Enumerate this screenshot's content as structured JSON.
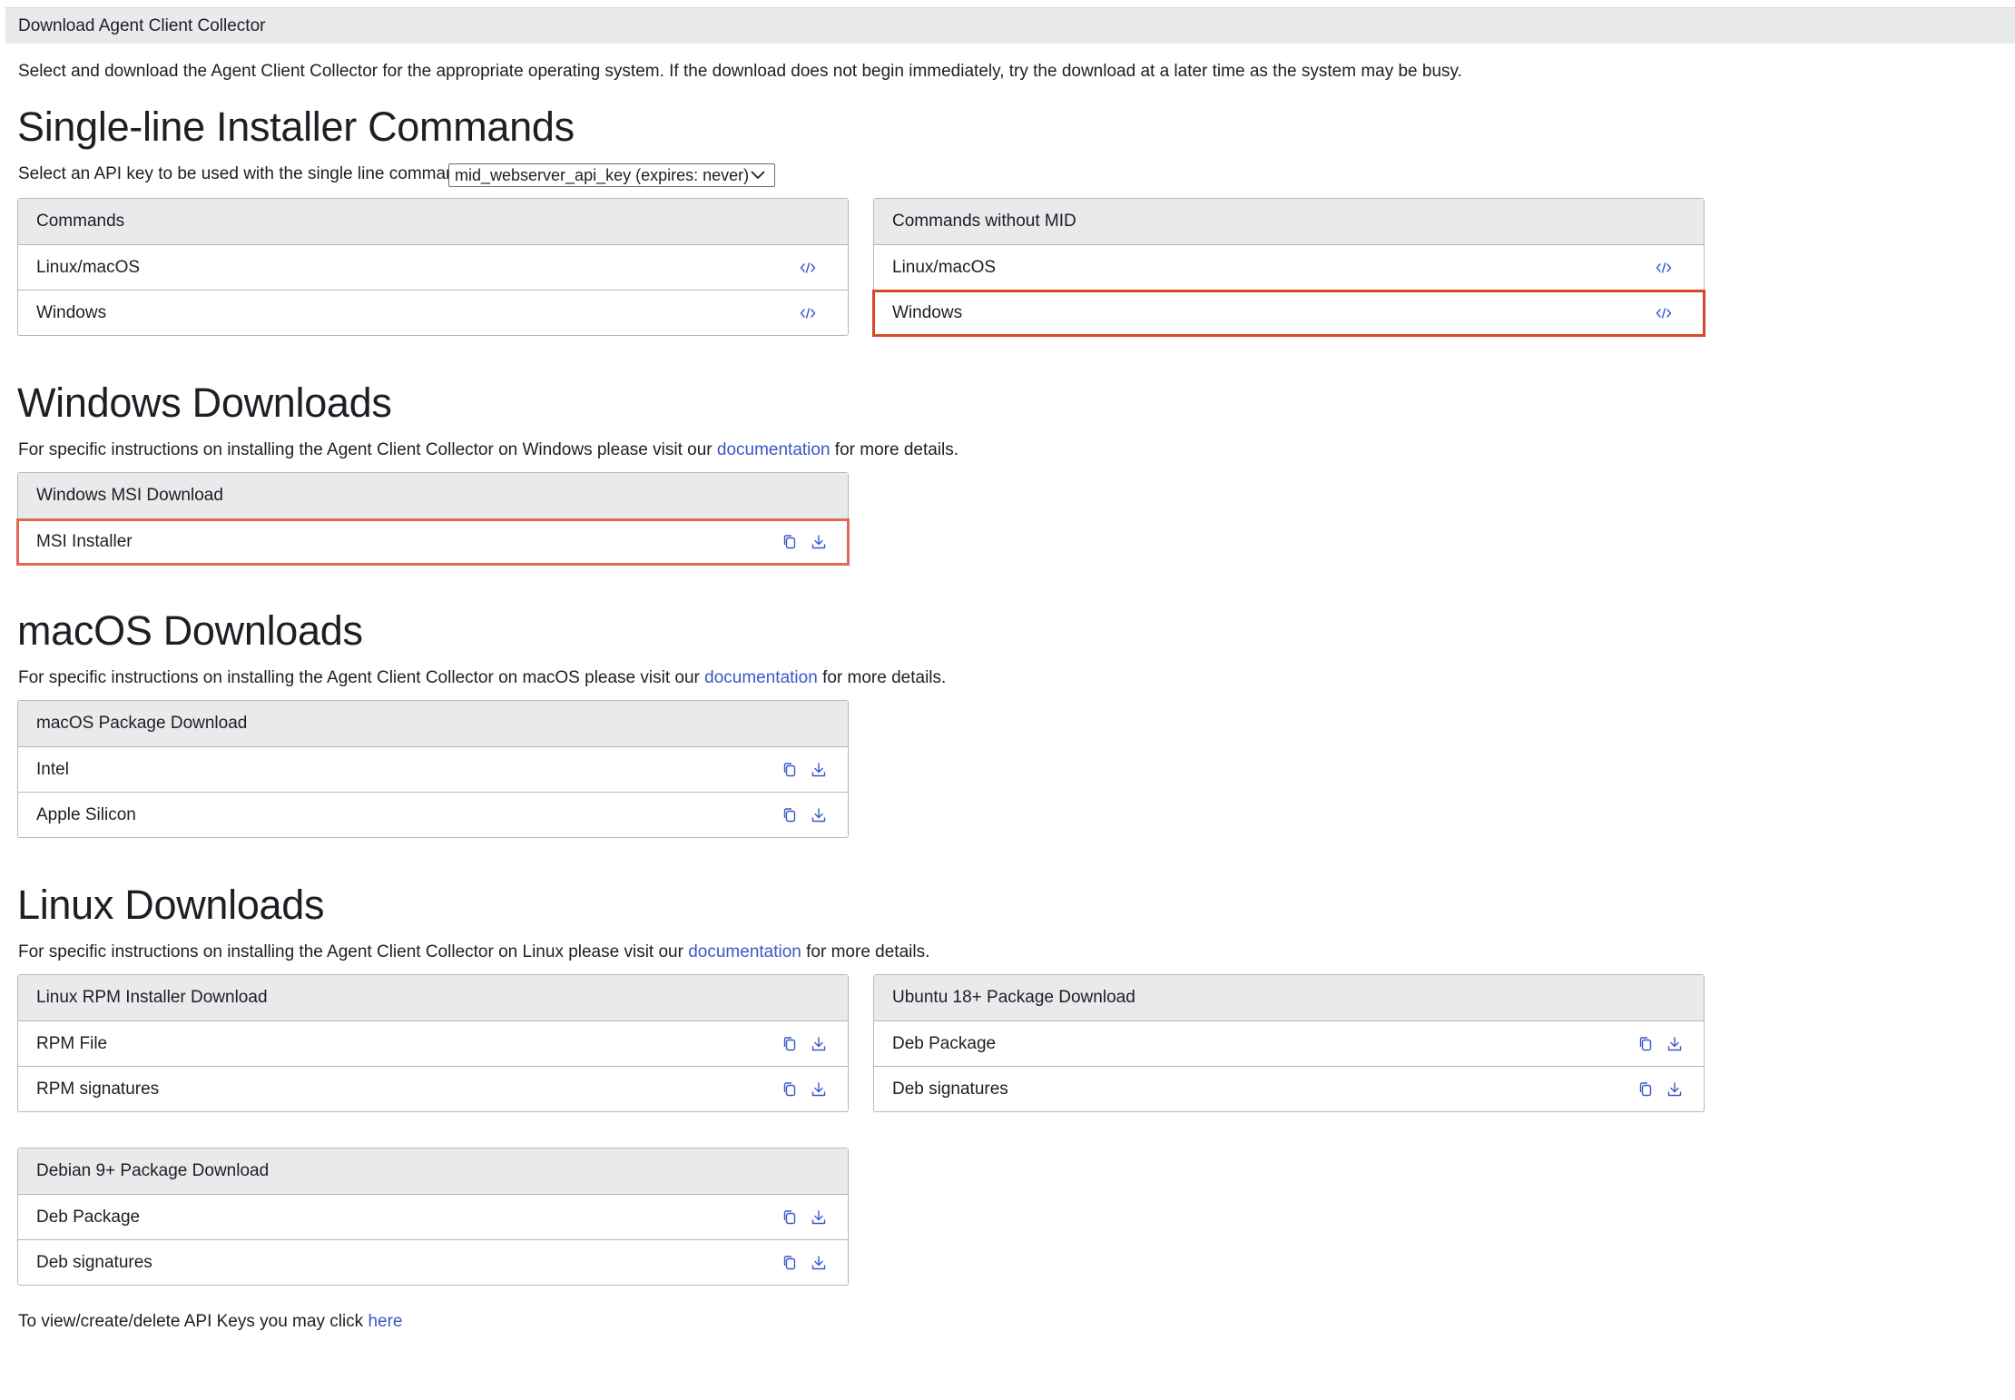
{
  "window": {
    "title": "Download Agent Client Collector"
  },
  "intro": "Select and download the Agent Client Collector for the appropriate operating system. If the download does not begin immediately, try the download at a later time as the system may be busy.",
  "single_line": {
    "heading": "Single-line Installer Commands",
    "api_key_label": "Select an API key to be used with the single line command:",
    "api_key_value": "mid_webserver_api_key (expires: never)",
    "commands_panel": {
      "title": "Commands",
      "rows": [
        "Linux/macOS",
        "Windows"
      ]
    },
    "commands_no_mid_panel": {
      "title": "Commands without MID",
      "rows": [
        "Linux/macOS",
        "Windows"
      ]
    }
  },
  "windows": {
    "heading": "Windows Downloads",
    "desc_before": "For specific instructions on installing the Agent Client Collector on Windows please visit our ",
    "link": "documentation",
    "desc_after": " for more details.",
    "panel": {
      "title": "Windows MSI Download",
      "rows": [
        "MSI Installer"
      ]
    }
  },
  "macos": {
    "heading": "macOS Downloads",
    "desc_before": "For specific instructions on installing the Agent Client Collector on macOS please visit our ",
    "link": "documentation",
    "desc_after": " for more details.",
    "panel": {
      "title": "macOS Package Download",
      "rows": [
        "Intel",
        "Apple Silicon"
      ]
    }
  },
  "linux": {
    "heading": "Linux Downloads",
    "desc_before": "For specific instructions on installing the Agent Client Collector on Linux please visit our ",
    "link": "documentation",
    "desc_after": " for more details.",
    "rpm_panel": {
      "title": "Linux RPM Installer Download",
      "rows": [
        "RPM File",
        "RPM signatures"
      ]
    },
    "ubuntu_panel": {
      "title": "Ubuntu 18+ Package Download",
      "rows": [
        "Deb Package",
        "Deb signatures"
      ]
    },
    "debian_panel": {
      "title": "Debian 9+ Package Download",
      "rows": [
        "Deb Package",
        "Deb signatures"
      ]
    }
  },
  "footer": {
    "text": "To view/create/delete API Keys you may click ",
    "link": "here"
  },
  "icons": {
    "code": "code-icon",
    "copy": "copy-icon",
    "download": "download-icon"
  },
  "colors": {
    "link": "#3a57c9",
    "icon": "#3a57c9",
    "highlight": "#d9472b",
    "panel_header": "#e9eaec"
  }
}
